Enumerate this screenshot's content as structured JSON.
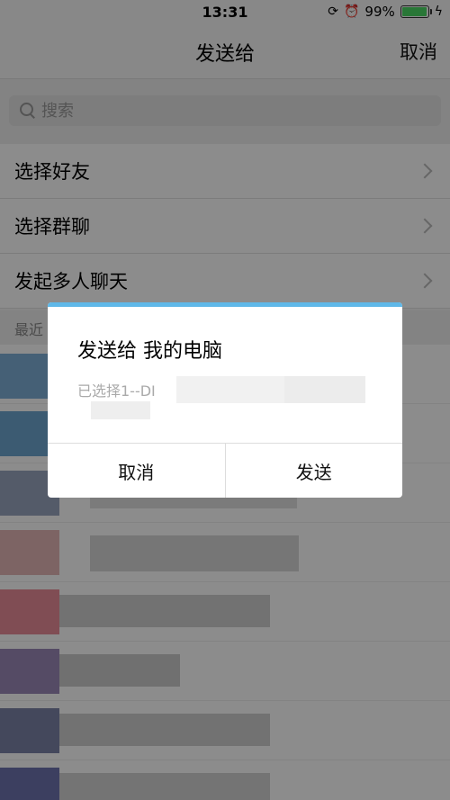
{
  "status_bar": {
    "time": "13:31",
    "battery_percent": "99%",
    "battery_level": 0.99,
    "icons": [
      "rotation-lock-icon",
      "alarm-icon",
      "battery-icon",
      "charging-icon"
    ]
  },
  "nav": {
    "title": "发送给",
    "cancel_label": "取消"
  },
  "search": {
    "placeholder": "搜索"
  },
  "menu": {
    "items": [
      {
        "label": "选择好友"
      },
      {
        "label": "选择群聊"
      },
      {
        "label": "发起多人聊天"
      }
    ]
  },
  "recent": {
    "header": "最近"
  },
  "dialog": {
    "title": "发送给 我的电脑",
    "description": "已选择1--DI",
    "cancel_label": "取消",
    "send_label": "发送"
  },
  "colors": {
    "dialog_accent": "#5fb8e8",
    "battery": "#4cd964"
  }
}
